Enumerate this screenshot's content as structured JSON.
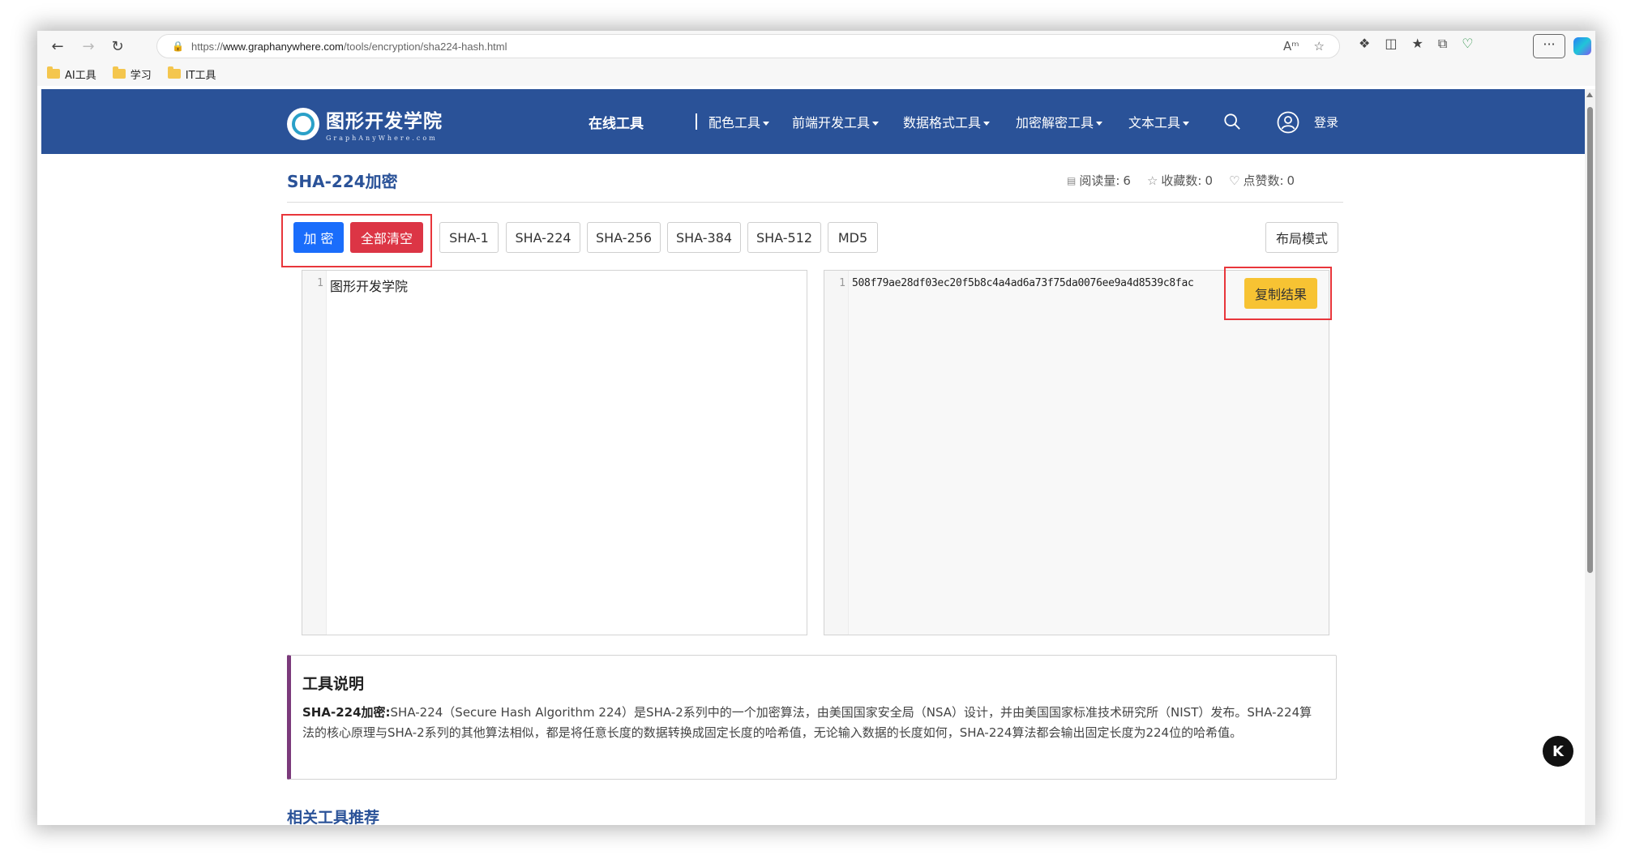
{
  "browser": {
    "url_prefix": "https://",
    "url_domain": "www.graphanywhere.com",
    "url_path": "/tools/encryption/sha224-hash.html",
    "more_label": "···"
  },
  "bookmarks": [
    {
      "label": "AI工具"
    },
    {
      "label": "学习"
    },
    {
      "label": "IT工具"
    }
  ],
  "site": {
    "logo_cn": "图形开发学院",
    "logo_en": "GraphAnyWhere.com",
    "nav": {
      "online_tools": "在线工具",
      "color_tools": "配色工具",
      "frontend_tools": "前端开发工具",
      "data_format_tools": "数据格式工具",
      "crypto_tools": "加密解密工具",
      "text_tools": "文本工具",
      "login": "登录"
    },
    "accent_color": "#2a5298"
  },
  "page": {
    "title": "SHA-224加密",
    "stats": {
      "reads_label": "阅读量:",
      "reads_value": "6",
      "favorites_label": "收藏数:",
      "favorites_value": "0",
      "likes_label": "点赞数:",
      "likes_value": "0"
    }
  },
  "toolbar": {
    "encrypt": "加 密",
    "clear_all": "全部清空",
    "algorithms": [
      "SHA-1",
      "SHA-224",
      "SHA-256",
      "SHA-384",
      "SHA-512",
      "MD5"
    ],
    "layout_mode": "布局模式"
  },
  "input_editor": {
    "line_number": "1",
    "content": "图形开发学院"
  },
  "output_editor": {
    "line_number": "1",
    "content": "508f79ae28df03ec20f5b8c4a4ad6a73f75da0076ee9a4d8539c8fac",
    "copy_button": "复制结果"
  },
  "description": {
    "heading": "工具说明",
    "term": "SHA-224加密:",
    "text": "SHA-224（Secure Hash Algorithm 224）是SHA-2系列中的一个加密算法，由美国国家安全局（NSA）设计，并由美国国家标准技术研究所（NIST）发布。SHA-224算法的核心原理与SHA-2系列的其他算法相似，都是将任意长度的数据转换成固定长度的哈希值，无论输入数据的长度如何，SHA-224算法都会输出固定长度为224位的哈希值。"
  },
  "related_heading": "相关工具推荐"
}
